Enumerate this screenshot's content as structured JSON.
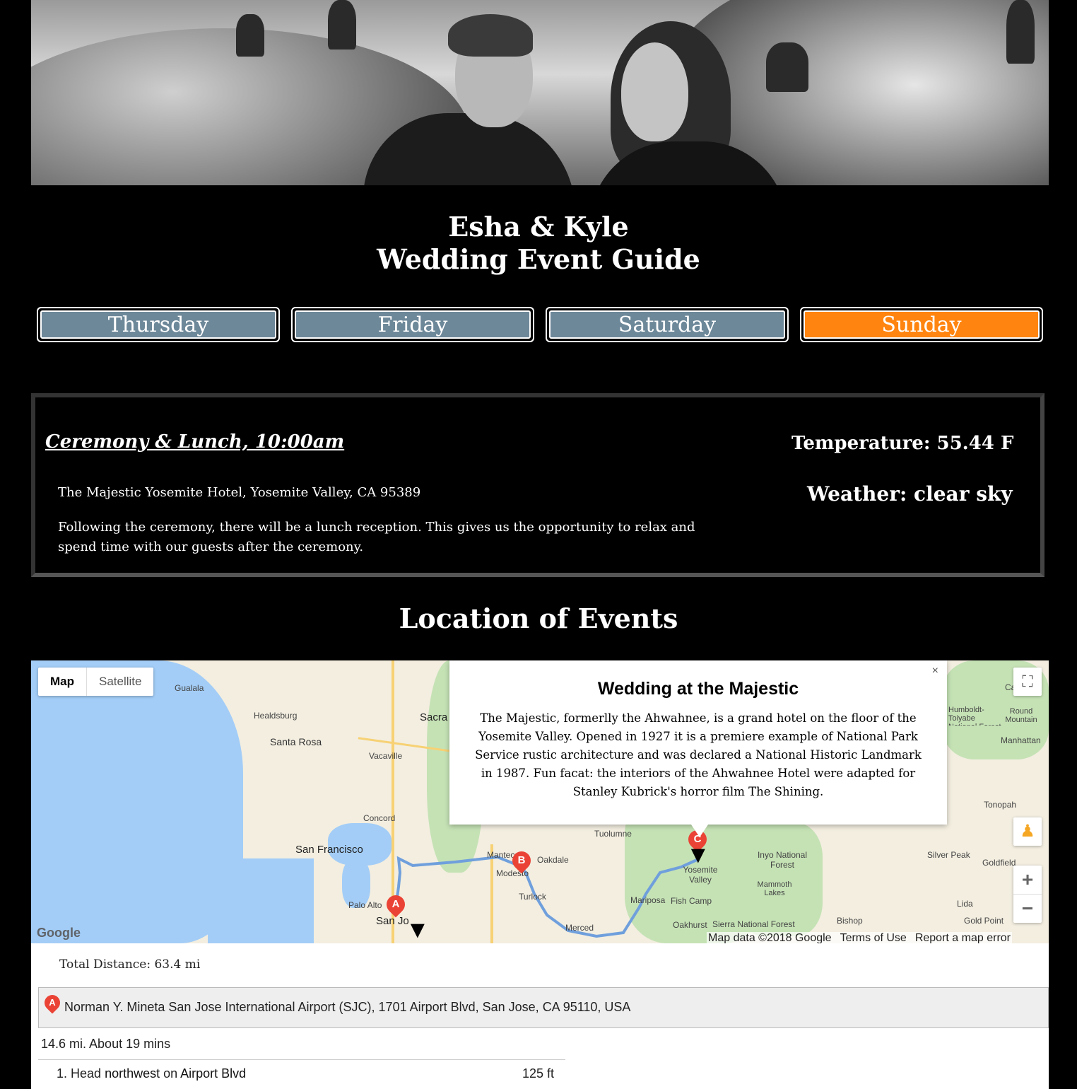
{
  "header": {
    "couple": "Esha & Kyle",
    "subtitle": "Wedding Event Guide"
  },
  "tabs": [
    {
      "label": "Thursday",
      "active": false
    },
    {
      "label": "Friday",
      "active": false
    },
    {
      "label": "Saturday",
      "active": false
    },
    {
      "label": "Sunday",
      "active": true
    }
  ],
  "colors": {
    "tab_default": "#6d8899",
    "tab_active": "#ff8510"
  },
  "event": {
    "title": "Ceremony & Lunch, 10:00am",
    "address": "The Majestic Yosemite Hotel, Yosemite Valley, CA 95389",
    "description": "Following the ceremony, there will be a lunch reception. This gives us the opportunity to relax and spend time with our guests after the ceremony.",
    "temperature": "Temperature: 55.44 F",
    "weather": "Weather: clear sky"
  },
  "location_title": "Location of Events",
  "map": {
    "type_map": "Map",
    "type_satellite": "Satellite",
    "labels": [
      "Gualala",
      "Healdsburg",
      "Santa Rosa",
      "Vacaville",
      "Sacra",
      "Concord",
      "San Francisco",
      "Palo Alto",
      "San Jo",
      "Manteca",
      "Oakdale",
      "Modesto",
      "Turlock",
      "Merced",
      "Tuolumne",
      "Mariposa",
      "Fish Camp",
      "Yosemite Valley",
      "Oakhurst",
      "Sierra National Forest",
      "Inyo National Forest",
      "Mammoth Lakes",
      "Bishop",
      "Silver Peak",
      "Goldfield",
      "Lida",
      "Gold Point",
      "Tonopah",
      "Manhattan",
      "Round Mountain",
      "Humboldt-Toiyabe National Forest",
      "Carver"
    ],
    "markers": [
      "A",
      "B",
      "C"
    ],
    "google": "Google",
    "attribution": [
      "Map data ©2018 Google",
      "Terms of Use",
      "Report a map error"
    ],
    "info": {
      "title": "Wedding at the Majestic",
      "body": "The Majestic, formerlly the Ahwahnee, is a grand hotel on the floor of the Yosemite Valley. Opened in 1927 it is a premiere example of National Park Service rustic architecture and was declared a National Historic Landmark in 1987. Fun facat: the interiors of the Ahwahnee Hotel were adapted for Stanley Kubrick's horror film The Shining.",
      "close": "×"
    }
  },
  "directions": {
    "total": "Total Distance: 63.4 mi",
    "start_marker": "A",
    "start": "Norman Y. Mineta San Jose International Airport (SJC), 1701 Airport Blvd, San Jose, CA 95110, USA",
    "summary": "14.6 mi. About 19 mins",
    "steps": [
      {
        "num": "1.",
        "pre": "Head ",
        "dir": "northwest",
        "mid": " on ",
        "road": "Airport Blvd",
        "dist": "125 ft"
      }
    ]
  }
}
